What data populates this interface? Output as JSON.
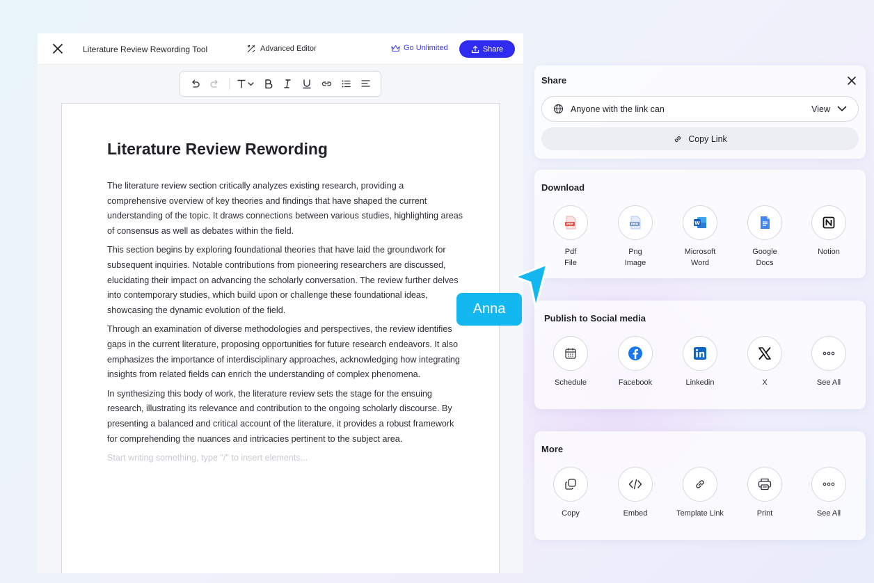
{
  "editor": {
    "doc_title": "Literature Review Rewording Tool",
    "advanced_editor": "Advanced Editor",
    "go_unlimited": "Go Unlimited",
    "share_label": "Share",
    "heading": "Literature Review Rewording",
    "paragraphs": [
      "The literature review section critically analyzes existing research, providing a comprehensive overview of key theories and findings that have shaped the current understanding of the topic. It draws connections between various studies, highlighting areas of consensus as well as debates within the field.",
      "This section begins by exploring foundational theories that have laid the groundwork for subsequent inquiries. Notable contributions from pioneering researchers are discussed, elucidating their impact on advancing the scholarly conversation. The review further delves into contemporary studies, which build upon or challenge these foundational ideas, showcasing the dynamic evolution of the field.",
      "Through an examination of diverse methodologies and perspectives, the review identifies gaps in the current literature, proposing opportunities for future research endeavors. It also emphasizes the importance of interdisciplinary approaches, acknowledging how integrating insights from related fields can enrich the understanding of complex phenomena.",
      "In synthesizing this body of work, the literature review sets the stage for the ensuing research, illustrating its relevance and contribution to the ongoing scholarly discourse. By presenting a balanced and critical account of the literature, it provides a robust framework for comprehending the nuances and intricacies pertinent to the subject area."
    ],
    "placeholder": "Start writing something, type \"/\" to insert elements..."
  },
  "share_panel": {
    "title": "Share",
    "access_label": "Anyone with the link can",
    "permission": "View",
    "copy_link": "Copy Link"
  },
  "download_panel": {
    "title": "Download",
    "items": [
      {
        "label": "Pdf\nFile",
        "icon": "pdf-file-icon"
      },
      {
        "label": "Png\nImage",
        "icon": "png-image-icon"
      },
      {
        "label": "Microsoft\nWord",
        "icon": "microsoft-word-icon"
      },
      {
        "label": "Google\nDocs",
        "icon": "google-docs-icon"
      },
      {
        "label": "Notion",
        "icon": "notion-icon"
      }
    ]
  },
  "social_panel": {
    "title": "Publish to Social media",
    "items": [
      {
        "label": "Schedule",
        "icon": "calendar-icon"
      },
      {
        "label": "Facebook",
        "icon": "facebook-icon"
      },
      {
        "label": "Linkedin",
        "icon": "linkedin-icon"
      },
      {
        "label": "X",
        "icon": "x-icon"
      },
      {
        "label": "See All",
        "icon": "more-dots-icon"
      }
    ]
  },
  "more_panel": {
    "title": "More",
    "items": [
      {
        "label": "Copy",
        "icon": "copy-icon"
      },
      {
        "label": "Embed",
        "icon": "code-icon"
      },
      {
        "label": "Template Link",
        "icon": "link-icon"
      },
      {
        "label": "Print",
        "icon": "printer-icon"
      },
      {
        "label": "See All",
        "icon": "more-dots-icon"
      }
    ]
  },
  "cursor": {
    "name": "Anna"
  },
  "colors": {
    "primary": "#2f2bf0",
    "cursor_tag": "#14b8f0",
    "facebook": "#1877f2",
    "linkedin": "#0a66c2",
    "word": "#185abd",
    "google_docs": "#4285f4",
    "pdf": "#e94b3c"
  }
}
